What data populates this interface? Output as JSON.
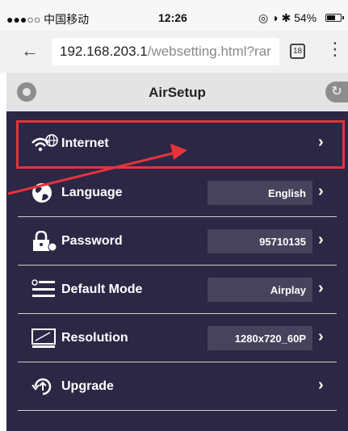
{
  "status_bar": {
    "carrier": "●●●○○ 中国移动",
    "time": "12:26",
    "icons": "◎ ◑ ✱ 54%"
  },
  "browser": {
    "url_host": "192.168.203.1",
    "url_path": "/websetting.html?rar",
    "tab_count": "18"
  },
  "header": {
    "title": "AirSetup"
  },
  "settings": [
    {
      "label": "Internet",
      "value": "",
      "icon": "wifi-globe-icon"
    },
    {
      "label": "Language",
      "value": "English",
      "icon": "globe-icon"
    },
    {
      "label": "Password",
      "value": "95710135",
      "icon": "lock-icon"
    },
    {
      "label": "Default Mode",
      "value": "Airplay",
      "icon": "list-mode-icon"
    },
    {
      "label": "Resolution",
      "value": "1280x720_60P",
      "icon": "monitor-icon"
    },
    {
      "label": "Upgrade",
      "value": "",
      "icon": "upgrade-icon"
    }
  ],
  "colors": {
    "panel_bg": "#2b2745",
    "value_bg": "#47435c",
    "annotation_red": "#e8323c",
    "header_bg": "#e4e4e4"
  }
}
